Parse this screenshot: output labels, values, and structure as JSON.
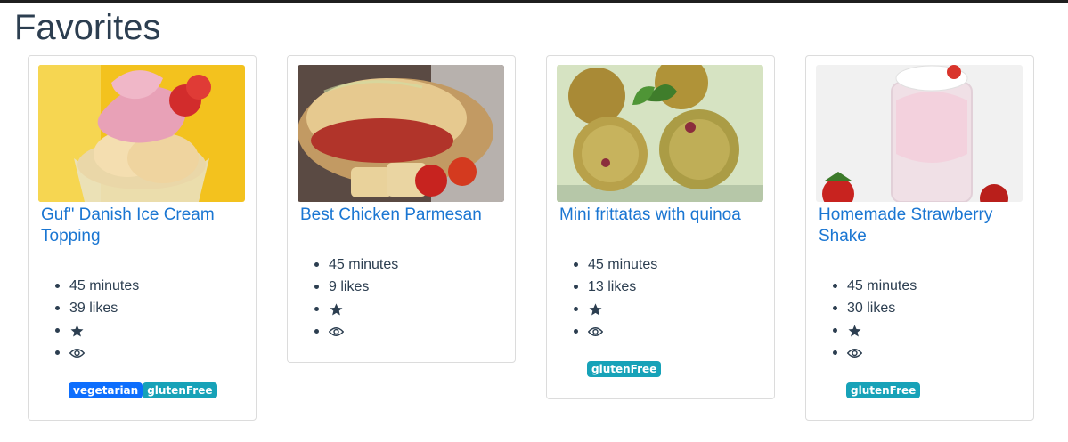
{
  "page": {
    "title": "Favorites"
  },
  "colors": {
    "vegetarian": "#0d6efd",
    "glutenFree": "#17a2b8",
    "title_link": "#1a76d2"
  },
  "recipes": [
    {
      "title": "Guf\" Danish Ice Cream Topping",
      "time": "45 minutes",
      "likes": "39 likes",
      "icons": [
        "star-icon",
        "eye-icon"
      ],
      "tags": [
        "vegetarian",
        "glutenFree"
      ]
    },
    {
      "title": "Best Chicken Parmesan",
      "time": "45 minutes",
      "likes": "9 likes",
      "icons": [
        "star-icon",
        "eye-icon"
      ],
      "tags": []
    },
    {
      "title": "Mini frittatas with quinoa",
      "time": "45 minutes",
      "likes": "13 likes",
      "icons": [
        "star-icon",
        "eye-icon"
      ],
      "tags": [
        "glutenFree"
      ]
    },
    {
      "title": "Homemade Strawberry Shake",
      "time": "45 minutes",
      "likes": "30 likes",
      "icons": [
        "star-icon",
        "eye-icon"
      ],
      "tags": [
        "glutenFree"
      ]
    }
  ]
}
